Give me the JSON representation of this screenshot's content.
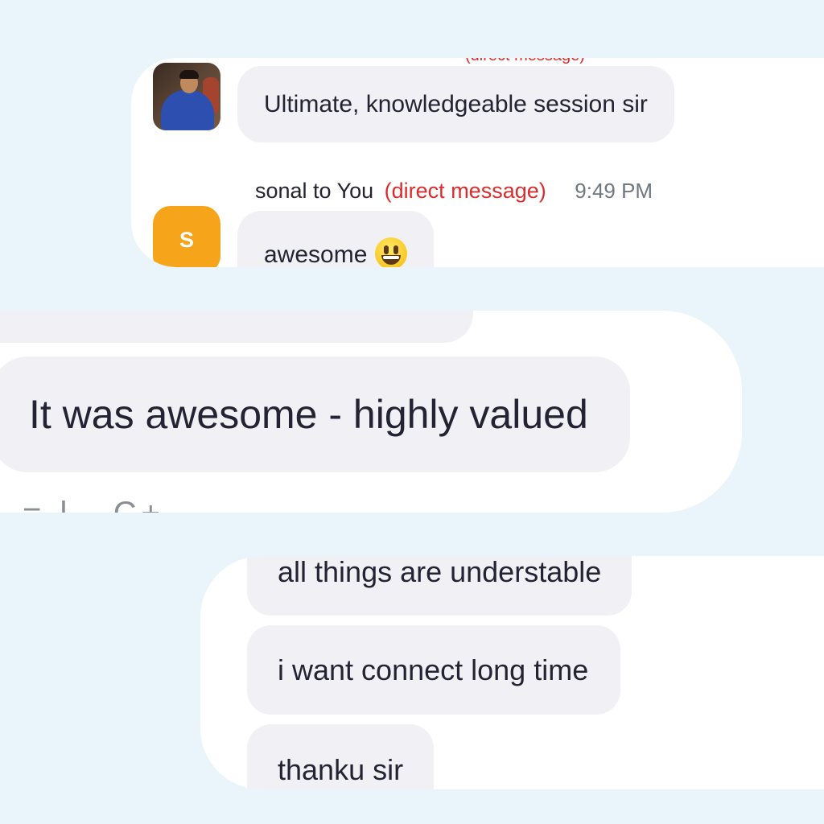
{
  "messages_top": {
    "cut_off_label": "(direct message)",
    "first_message": "Ultimate, knowledgeable session sir",
    "second_meta": {
      "sender": "sonal to You",
      "tag": "(direct message)",
      "time": "9:49 PM"
    },
    "avatar_initial": "S",
    "second_message": "awesome",
    "emoji": "grinning-face"
  },
  "messages_middle": {
    "message": "It was awesome - highly valued",
    "cut_off_text": "= l.. C+"
  },
  "messages_bottom": {
    "messages": [
      "all things are understable",
      "i want connect long time",
      "thanku sir"
    ]
  }
}
